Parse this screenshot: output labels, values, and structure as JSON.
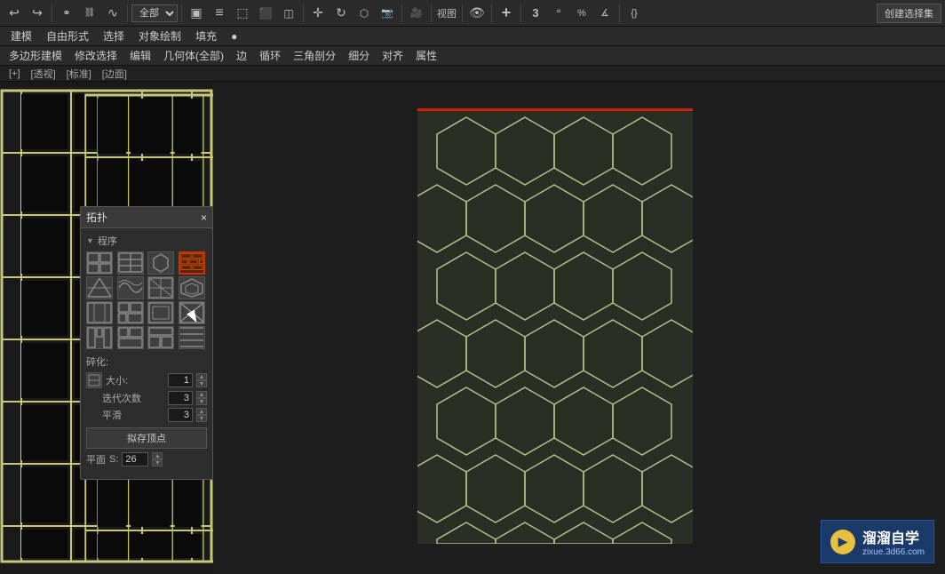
{
  "toolbar": {
    "dropdown_options": [
      "全部"
    ],
    "dropdown_selected": "全部",
    "view_label": "视图",
    "create_sel_label": "创建选择集"
  },
  "menu_bar": {
    "items": [
      "建模",
      "自由形式",
      "选择",
      "对象绘制",
      "填充",
      "●"
    ]
  },
  "sub_toolbar": {
    "items": [
      "多边形建模",
      "修改选择",
      "编辑",
      "几何体(全部)",
      "边",
      "循环",
      "三角剖分",
      "细分",
      "对齐",
      "属性"
    ]
  },
  "viewport_labels": {
    "items": [
      "[+]",
      "[透视]",
      "[标准]",
      "[边面]"
    ]
  },
  "topology_panel": {
    "title": "拓扑",
    "close": "×",
    "program_label": "程序",
    "patterns": [
      {
        "id": 0,
        "type": "grid"
      },
      {
        "id": 1,
        "type": "grid2"
      },
      {
        "id": 2,
        "type": "grid3"
      },
      {
        "id": 3,
        "type": "brick",
        "selected": true
      },
      {
        "id": 4,
        "type": "tri"
      },
      {
        "id": 5,
        "type": "tri2"
      },
      {
        "id": 6,
        "type": "tri3"
      },
      {
        "id": 7,
        "type": "tri4"
      },
      {
        "id": 8,
        "type": "hex"
      },
      {
        "id": 9,
        "type": "hex2"
      },
      {
        "id": 10,
        "type": "hex3"
      },
      {
        "id": 11,
        "type": "hex4"
      },
      {
        "id": 12,
        "type": "custom"
      },
      {
        "id": 13,
        "type": "custom2"
      },
      {
        "id": 14,
        "type": "custom3"
      },
      {
        "id": 15,
        "type": "custom4"
      }
    ],
    "frag_label": "碎化:",
    "size_label": "大小:",
    "size_value": "1",
    "iter_label": "迭代次数",
    "iter_value": "3",
    "smooth_label": "平滑",
    "smooth_value": "3",
    "store_btn": "拟存顶点",
    "plane_label": "平面",
    "s_label": "S:",
    "s_value": "26"
  },
  "watermark": {
    "title": "溜溜自学",
    "url": "zixue.3d66.com"
  }
}
